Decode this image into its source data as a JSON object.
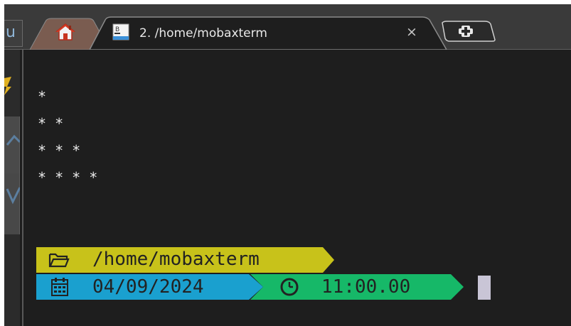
{
  "left_stub_text": "u",
  "tabs": [
    {
      "label": "",
      "kind": "home",
      "icon": "home-icon"
    },
    {
      "label": "2. /home/mobaxterm",
      "kind": "terminal",
      "icon": "terminal-icon",
      "close_glyph": "×"
    }
  ],
  "new_tab_glyph": "+",
  "terminal": {
    "output_lines": [
      "*",
      "* *",
      "* * *",
      "* * * *"
    ],
    "prompt": {
      "path": "/home/mobaxterm",
      "date": "04/09/2024",
      "time": "11:00.00"
    }
  },
  "colors": {
    "path_segment": "#c8c21a",
    "date_segment": "#1aa0cf",
    "time_segment": "#16b868",
    "terminal_bg": "#1e1e1e",
    "prompt_text": "#222222"
  }
}
